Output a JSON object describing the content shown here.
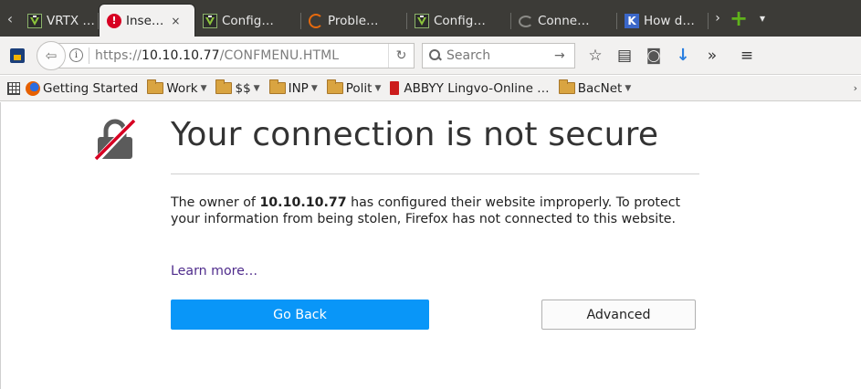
{
  "tabs": [
    {
      "label": "VRTX …",
      "icon": "vrtx-icon",
      "active": false
    },
    {
      "label": "Inse…",
      "icon": "warning-icon",
      "active": true
    },
    {
      "label": "Config…",
      "icon": "vrtx-icon",
      "active": false
    },
    {
      "label": "Proble…",
      "icon": "loading-ring-icon",
      "active": false
    },
    {
      "label": "Config…",
      "icon": "vrtx-icon",
      "active": false
    },
    {
      "label": "Conne…",
      "icon": "loading-spinner-icon",
      "active": false
    },
    {
      "label": "How d…",
      "icon": "k-icon",
      "active": false
    }
  ],
  "tab_close_glyph": "×",
  "navbar": {
    "url_prefix": "https://",
    "url_host": "10.10.10.77",
    "url_path": "/CONFMENU.HTML",
    "search_placeholder": "Search"
  },
  "bookmarks": [
    {
      "label": "Getting Started",
      "icon": "firefox-icon",
      "folder": false
    },
    {
      "label": "Work",
      "icon": "folder-icon",
      "folder": true
    },
    {
      "label": "$$",
      "icon": "folder-icon",
      "folder": true
    },
    {
      "label": "INP",
      "icon": "folder-icon",
      "folder": true
    },
    {
      "label": "Polit",
      "icon": "folder-icon",
      "folder": true
    },
    {
      "label": "ABBYY Lingvo-Online …",
      "icon": "abbyy-icon",
      "folder": false
    },
    {
      "label": "BacNet",
      "icon": "folder-icon",
      "folder": true
    }
  ],
  "error_page": {
    "title": "Your connection is not secure",
    "desc_before": "The owner of ",
    "desc_host": "10.10.10.77",
    "desc_after": " has configured their website improperly. To protect your information from being stolen, Firefox has not connected to this website.",
    "learn_more": "Learn more…",
    "go_back": "Go Back",
    "advanced": "Advanced"
  },
  "colors": {
    "primary_button": "#0996f8",
    "link": "#4f2c8c",
    "tabbar_bg": "#3c3b37",
    "warning_red": "#d70022"
  }
}
